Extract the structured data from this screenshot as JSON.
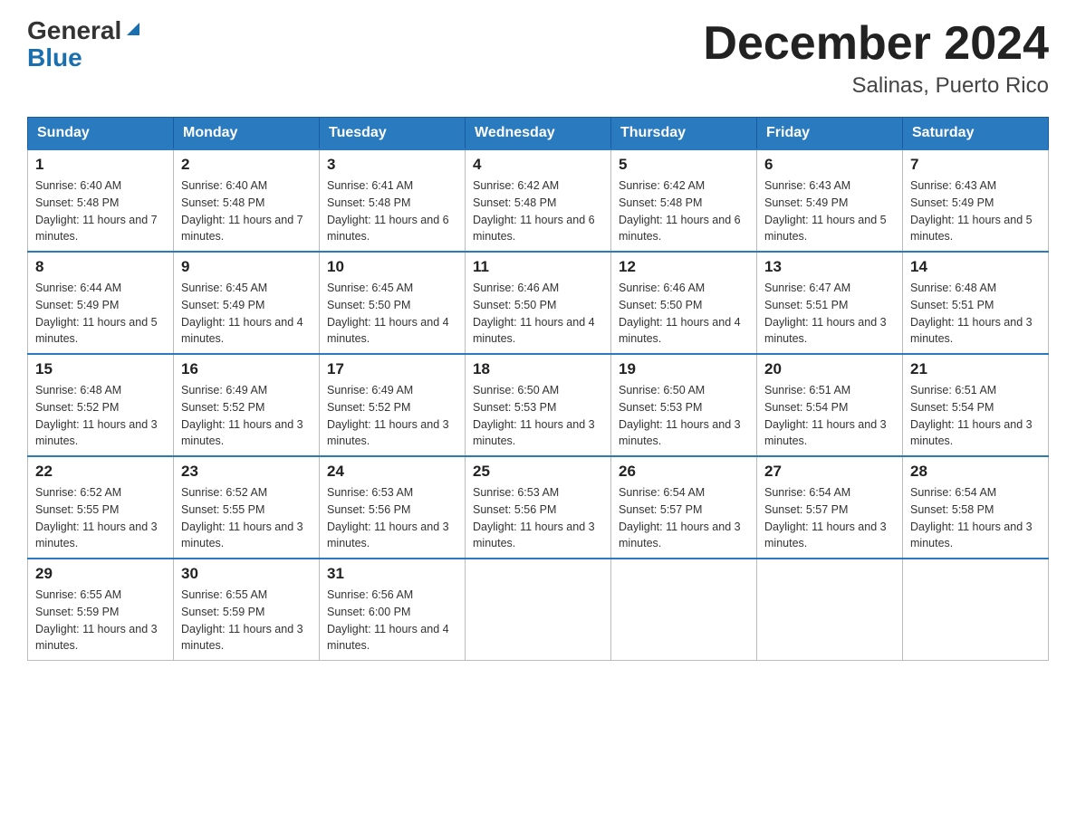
{
  "header": {
    "logo_general": "General",
    "logo_blue": "Blue",
    "month_title": "December 2024",
    "location": "Salinas, Puerto Rico"
  },
  "weekdays": [
    "Sunday",
    "Monday",
    "Tuesday",
    "Wednesday",
    "Thursday",
    "Friday",
    "Saturday"
  ],
  "weeks": [
    [
      {
        "day": "1",
        "sunrise": "6:40 AM",
        "sunset": "5:48 PM",
        "daylight": "11 hours and 7 minutes."
      },
      {
        "day": "2",
        "sunrise": "6:40 AM",
        "sunset": "5:48 PM",
        "daylight": "11 hours and 7 minutes."
      },
      {
        "day": "3",
        "sunrise": "6:41 AM",
        "sunset": "5:48 PM",
        "daylight": "11 hours and 6 minutes."
      },
      {
        "day": "4",
        "sunrise": "6:42 AM",
        "sunset": "5:48 PM",
        "daylight": "11 hours and 6 minutes."
      },
      {
        "day": "5",
        "sunrise": "6:42 AM",
        "sunset": "5:48 PM",
        "daylight": "11 hours and 6 minutes."
      },
      {
        "day": "6",
        "sunrise": "6:43 AM",
        "sunset": "5:49 PM",
        "daylight": "11 hours and 5 minutes."
      },
      {
        "day": "7",
        "sunrise": "6:43 AM",
        "sunset": "5:49 PM",
        "daylight": "11 hours and 5 minutes."
      }
    ],
    [
      {
        "day": "8",
        "sunrise": "6:44 AM",
        "sunset": "5:49 PM",
        "daylight": "11 hours and 5 minutes."
      },
      {
        "day": "9",
        "sunrise": "6:45 AM",
        "sunset": "5:49 PM",
        "daylight": "11 hours and 4 minutes."
      },
      {
        "day": "10",
        "sunrise": "6:45 AM",
        "sunset": "5:50 PM",
        "daylight": "11 hours and 4 minutes."
      },
      {
        "day": "11",
        "sunrise": "6:46 AM",
        "sunset": "5:50 PM",
        "daylight": "11 hours and 4 minutes."
      },
      {
        "day": "12",
        "sunrise": "6:46 AM",
        "sunset": "5:50 PM",
        "daylight": "11 hours and 4 minutes."
      },
      {
        "day": "13",
        "sunrise": "6:47 AM",
        "sunset": "5:51 PM",
        "daylight": "11 hours and 3 minutes."
      },
      {
        "day": "14",
        "sunrise": "6:48 AM",
        "sunset": "5:51 PM",
        "daylight": "11 hours and 3 minutes."
      }
    ],
    [
      {
        "day": "15",
        "sunrise": "6:48 AM",
        "sunset": "5:52 PM",
        "daylight": "11 hours and 3 minutes."
      },
      {
        "day": "16",
        "sunrise": "6:49 AM",
        "sunset": "5:52 PM",
        "daylight": "11 hours and 3 minutes."
      },
      {
        "day": "17",
        "sunrise": "6:49 AM",
        "sunset": "5:52 PM",
        "daylight": "11 hours and 3 minutes."
      },
      {
        "day": "18",
        "sunrise": "6:50 AM",
        "sunset": "5:53 PM",
        "daylight": "11 hours and 3 minutes."
      },
      {
        "day": "19",
        "sunrise": "6:50 AM",
        "sunset": "5:53 PM",
        "daylight": "11 hours and 3 minutes."
      },
      {
        "day": "20",
        "sunrise": "6:51 AM",
        "sunset": "5:54 PM",
        "daylight": "11 hours and 3 minutes."
      },
      {
        "day": "21",
        "sunrise": "6:51 AM",
        "sunset": "5:54 PM",
        "daylight": "11 hours and 3 minutes."
      }
    ],
    [
      {
        "day": "22",
        "sunrise": "6:52 AM",
        "sunset": "5:55 PM",
        "daylight": "11 hours and 3 minutes."
      },
      {
        "day": "23",
        "sunrise": "6:52 AM",
        "sunset": "5:55 PM",
        "daylight": "11 hours and 3 minutes."
      },
      {
        "day": "24",
        "sunrise": "6:53 AM",
        "sunset": "5:56 PM",
        "daylight": "11 hours and 3 minutes."
      },
      {
        "day": "25",
        "sunrise": "6:53 AM",
        "sunset": "5:56 PM",
        "daylight": "11 hours and 3 minutes."
      },
      {
        "day": "26",
        "sunrise": "6:54 AM",
        "sunset": "5:57 PM",
        "daylight": "11 hours and 3 minutes."
      },
      {
        "day": "27",
        "sunrise": "6:54 AM",
        "sunset": "5:57 PM",
        "daylight": "11 hours and 3 minutes."
      },
      {
        "day": "28",
        "sunrise": "6:54 AM",
        "sunset": "5:58 PM",
        "daylight": "11 hours and 3 minutes."
      }
    ],
    [
      {
        "day": "29",
        "sunrise": "6:55 AM",
        "sunset": "5:59 PM",
        "daylight": "11 hours and 3 minutes."
      },
      {
        "day": "30",
        "sunrise": "6:55 AM",
        "sunset": "5:59 PM",
        "daylight": "11 hours and 3 minutes."
      },
      {
        "day": "31",
        "sunrise": "6:56 AM",
        "sunset": "6:00 PM",
        "daylight": "11 hours and 4 minutes."
      },
      null,
      null,
      null,
      null
    ]
  ]
}
